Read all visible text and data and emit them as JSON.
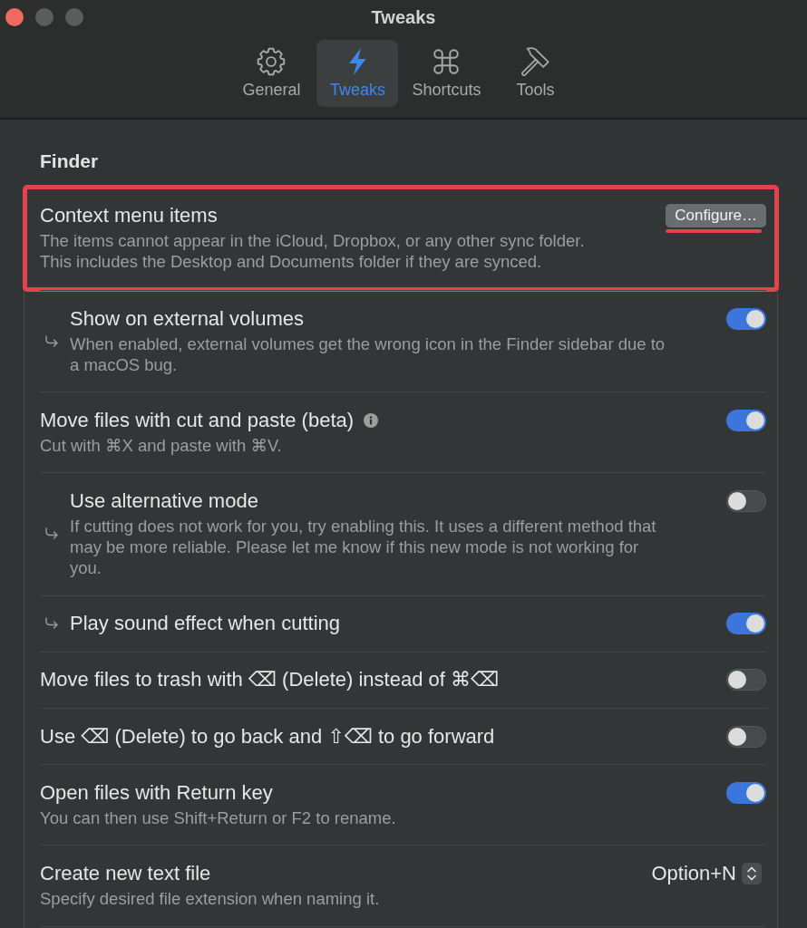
{
  "window": {
    "title": "Tweaks",
    "controls": [
      {
        "kind": "close",
        "disabled": false
      },
      {
        "kind": "minimize",
        "disabled": true
      },
      {
        "kind": "zoom",
        "disabled": true
      }
    ]
  },
  "tabs": [
    {
      "label": "General",
      "selected": false
    },
    {
      "label": "Tweaks",
      "selected": true
    },
    {
      "label": "Shortcuts",
      "selected": false
    },
    {
      "label": "Tools",
      "selected": false
    }
  ],
  "section": {
    "title": "Finder"
  },
  "settings": [
    {
      "kind": "button",
      "title": "Context menu items",
      "description": "The items cannot appear in the iCloud, Dropbox, or any other sync folder.\nThis includes the Desktop and Documents folder if they are synced.",
      "indented": false,
      "highlighted": true,
      "button": {
        "label": "Configure…",
        "underlined": true
      }
    },
    {
      "kind": "toggle",
      "title": "Show on external volumes",
      "description": "When enabled, external volumes get the wrong icon in the Finder sidebar due to\na macOS bug.",
      "indented": true,
      "highlighted": false,
      "on": true
    },
    {
      "kind": "toggle",
      "title": "Move files with cut and paste (beta)",
      "info": true,
      "description": "Cut with ⌘X and paste with ⌘V.",
      "indented": false,
      "highlighted": false,
      "on": true
    },
    {
      "kind": "toggle",
      "title": "Use alternative mode",
      "description": "If cutting does not work for you, try enabling this. It uses a different method that\nmay be more reliable. Please let me know if this new mode is not working for\nyou.",
      "indented": true,
      "highlighted": false,
      "on": false
    },
    {
      "kind": "toggle",
      "title": "Play sound effect when cutting",
      "indented": true,
      "highlighted": false,
      "on": true
    },
    {
      "kind": "toggle",
      "title": "Move files to trash with ⌫ (Delete) instead of ⌘⌫",
      "indented": false,
      "highlighted": false,
      "on": false
    },
    {
      "kind": "toggle",
      "title": "Use ⌫ (Delete) to go back and ⇧⌫ to go forward",
      "indented": false,
      "highlighted": false,
      "on": false
    },
    {
      "kind": "toggle",
      "title": "Open files with Return key",
      "description": "You can then use Shift+Return or F2 to rename.",
      "indented": false,
      "highlighted": false,
      "on": true
    },
    {
      "kind": "popup",
      "title": "Create new text file",
      "description": "Specify desired file extension when naming it.",
      "indented": false,
      "highlighted": false,
      "value": "Option+N"
    }
  ]
}
